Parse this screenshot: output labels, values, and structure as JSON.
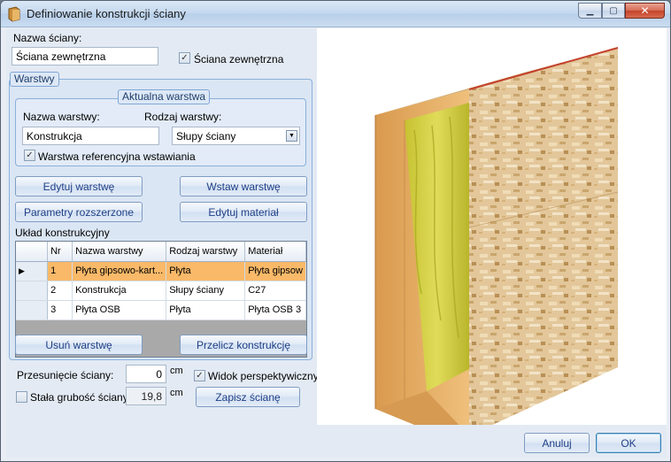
{
  "window": {
    "title": "Definiowanie konstrukcji ściany",
    "min_glyph": "▁",
    "max_glyph": "▢",
    "close_glyph": "✕"
  },
  "wall": {
    "name_label": "Nazwa ściany:",
    "name_value": "Ściana zewnętrzna",
    "exterior_label": "Ściana zewnętrzna",
    "exterior_checked": true
  },
  "layers": {
    "group_title": "Warstwy",
    "current_title": "Aktualna warstwa",
    "layer_name_label": "Nazwa warstwy:",
    "layer_name_value": "Konstrukcja",
    "layer_type_label": "Rodzaj warstwy:",
    "layer_type_value": "Słupy ściany",
    "reference_label": "Warstwa referencyjna wstawiania",
    "reference_checked": true,
    "buttons": {
      "edit_layer": "Edytuj warstwę",
      "insert_layer": "Wstaw warstwę",
      "extended_params": "Parametry rozszerzone",
      "edit_material": "Edytuj materiał",
      "delete_layer": "Usuń warstwę",
      "recalc": "Przelicz konstrukcję"
    },
    "grid_title": "Układ konstrukcyjny",
    "columns": [
      "Nr",
      "Nazwa warstwy",
      "Rodzaj warstwy",
      "Materiał"
    ],
    "rows": [
      {
        "row_marker": "▶",
        "nr": "1",
        "name": "Płyta gipsowo-kart...",
        "type": "Płyta",
        "material": "Płyta gipsow"
      },
      {
        "row_marker": "",
        "nr": "2",
        "name": "Konstrukcja",
        "type": "Słupy ściany",
        "material": "C27"
      },
      {
        "row_marker": "",
        "nr": "3",
        "name": "Płyta OSB",
        "type": "Płyta",
        "material": "Płyta OSB 3"
      }
    ]
  },
  "offset": {
    "label": "Przesunięcie ściany:",
    "value": "0",
    "unit": "cm"
  },
  "thickness": {
    "label": "Stała grubość ściany:",
    "value": "19,8",
    "unit": "cm",
    "checked": false
  },
  "perspective": {
    "label": "Widok perspektywiczny",
    "checked": true
  },
  "footer": {
    "save": "Zapisz ścianę",
    "cancel": "Anuluj",
    "ok": "OK"
  },
  "colors": {
    "accent": "#1f3f86",
    "selected_row": "#f9b969",
    "osb": "#e3c79a",
    "wood": "#e2a95e",
    "insulation": "#d4d14a"
  }
}
